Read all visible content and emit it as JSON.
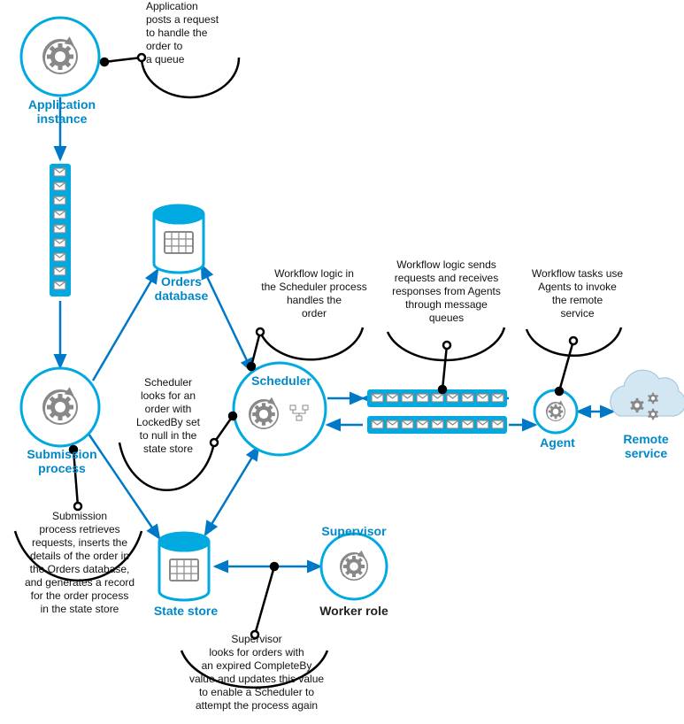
{
  "nodes": {
    "application_instance": "Application\ninstance",
    "submission_process": "Submission\nprocess",
    "orders_database": "Orders\ndatabase",
    "scheduler": "Scheduler",
    "state_store": "State store",
    "supervisor": "Supervisor",
    "worker_role": "Worker role",
    "agent": "Agent",
    "remote_service": "Remote\nservice"
  },
  "annotations": {
    "app_posts": "Application\nposts a request\nto handle the\norder to\na queue",
    "workflow_handles": "Workflow logic in\nthe Scheduler process\nhandles the\norder",
    "workflow_sends": "Workflow logic sends\nrequests and receives\nresponses from Agents\nthrough message\nqueues",
    "workflow_tasks": "Workflow tasks use\nAgents to invoke\nthe remote\nservice",
    "scheduler_looks": "Scheduler\nlooks for an\norder with\nLockedBy set\nto null in the\nstate store",
    "submission_desc": "Submission\nprocess retrieves\nrequests, inserts the\ndetails of the order in\nthe Orders database,\nand generates a record\nfor the order process\nin the state store",
    "supervisor_desc": "Supervisor\nlooks for orders with\nan expired CompleteBy\nvalue and updates this value\nto enable a Scheduler to\nattempt the process again"
  },
  "colors": {
    "brand": "#00a9e0",
    "label": "#0088c8",
    "arrow": "#0078c8"
  }
}
